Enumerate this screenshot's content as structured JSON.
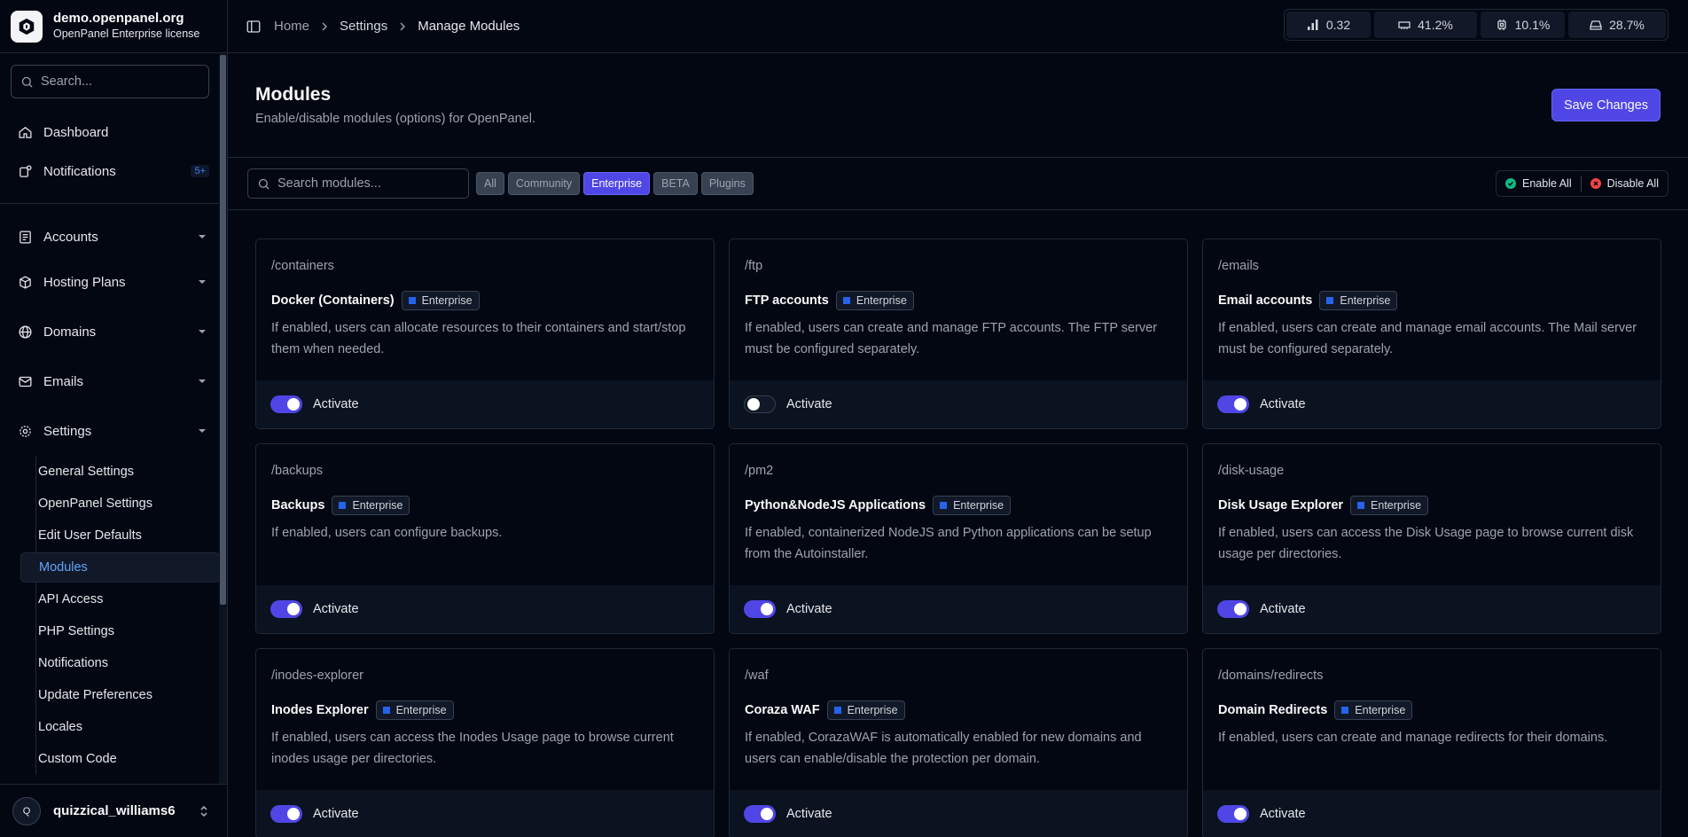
{
  "brand": {
    "domain": "demo.openpanel.org",
    "license": "OpenPanel Enterprise license"
  },
  "sidebar": {
    "search_placeholder": "Search...",
    "top_items": [
      {
        "label": "Dashboard",
        "icon": "home-icon"
      },
      {
        "label": "Notifications",
        "icon": "bell-icon",
        "badge": "5+"
      }
    ],
    "groups": [
      {
        "label": "Accounts",
        "icon": "user-list-icon"
      },
      {
        "label": "Hosting Plans",
        "icon": "package-icon"
      },
      {
        "label": "Domains",
        "icon": "globe-icon"
      },
      {
        "label": "Emails",
        "icon": "mail-icon"
      },
      {
        "label": "Settings",
        "icon": "gear-icon"
      }
    ],
    "settings_items": [
      "General Settings",
      "OpenPanel Settings",
      "Edit User Defaults",
      "Modules",
      "API Access",
      "PHP Settings",
      "Notifications",
      "Update Preferences",
      "Locales",
      "Custom Code"
    ],
    "active_item": "Modules"
  },
  "user": {
    "initial": "Q",
    "name": "quizzical_williams6"
  },
  "breadcrumb": {
    "home": "Home",
    "section": "Settings",
    "current": "Manage Modules"
  },
  "stats": {
    "load": "0.32",
    "memory": "41.2%",
    "cpu": "10.1%",
    "disk": "28.7%"
  },
  "page": {
    "title": "Modules",
    "subtitle": "Enable/disable modules (options) for OpenPanel.",
    "save_label": "Save Changes"
  },
  "filters": {
    "search_placeholder": "Search modules...",
    "chips": [
      "All",
      "Community",
      "Enterprise",
      "BETA",
      "Plugins"
    ],
    "active_chip": "Enterprise",
    "enable_all": "Enable All",
    "disable_all": "Disable All"
  },
  "activate_label": "Activate",
  "modules": [
    {
      "path": "/containers",
      "name": "Docker (Containers)",
      "tag": "Enterprise",
      "desc": "If enabled, users can allocate resources to their containers and start/stop them when needed.",
      "enabled": true
    },
    {
      "path": "/ftp",
      "name": "FTP accounts",
      "tag": "Enterprise",
      "desc": "If enabled, users can create and manage FTP accounts. The FTP server must be configured separately.",
      "enabled": false
    },
    {
      "path": "/emails",
      "name": "Email accounts",
      "tag": "Enterprise",
      "desc": "If enabled, users can create and manage email accounts. The Mail server must be configured separately.",
      "enabled": true
    },
    {
      "path": "/backups",
      "name": "Backups",
      "tag": "Enterprise",
      "desc": "If enabled, users can configure backups.",
      "enabled": true
    },
    {
      "path": "/pm2",
      "name": "Python&NodeJS Applications",
      "tag": "Enterprise",
      "desc": "If enabled, containerized NodeJS and Python applications can be setup from the Autoinstaller.",
      "enabled": true
    },
    {
      "path": "/disk-usage",
      "name": "Disk Usage Explorer",
      "tag": "Enterprise",
      "desc": "If enabled, users can access the Disk Usage page to browse current disk usage per directories.",
      "enabled": true
    },
    {
      "path": "/inodes-explorer",
      "name": "Inodes Explorer",
      "tag": "Enterprise",
      "desc": "If enabled, users can access the Inodes Usage page to browse current inodes usage per directories.",
      "enabled": true
    },
    {
      "path": "/waf",
      "name": "Coraza WAF",
      "tag": "Enterprise",
      "desc": "If enabled, CorazaWAF is automatically enabled for new domains and users can enable/disable the protection per domain.",
      "enabled": true
    },
    {
      "path": "/domains/redirects",
      "name": "Domain Redirects",
      "tag": "Enterprise",
      "desc": "If enabled, users can create and manage redirects for their domains.",
      "enabled": true
    }
  ]
}
